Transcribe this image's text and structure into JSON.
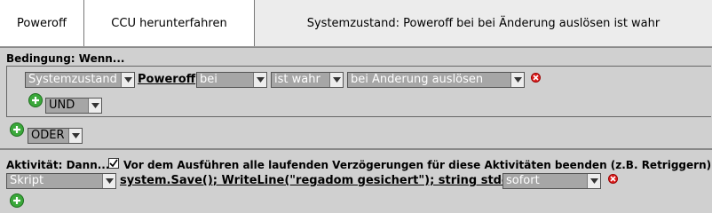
{
  "header": {
    "program_name": "Poweroff",
    "description": "CCU herunterfahren",
    "summary": "Systemzustand: Poweroff bei bei Änderung auslösen ist wahr"
  },
  "condition": {
    "title": "Bedingung: Wenn...",
    "row": {
      "type_select": "Systemzustand",
      "object_link": "Poweroff",
      "when_select": "bei",
      "state_select": "ist wahr",
      "trigger_select": "bei Änderung auslösen"
    },
    "and_select": "UND",
    "or_select": "ODER"
  },
  "activity": {
    "title": "Aktivität: Dann...",
    "retrigger_label": "Vor dem Ausführen alle laufenden Verzögerungen für diese Aktivitäten beenden (z.B. Retriggern).",
    "retrigger_checked": true,
    "action_select": "Skript",
    "script_link": "system.Save(); WriteLine(\"regadom gesichert\"); string stdout...",
    "timing_select": "sofort"
  },
  "icons": {
    "add": "add-icon",
    "delete": "delete-icon",
    "dropdown": "chevron-down-icon",
    "check": "checkmark-icon"
  }
}
